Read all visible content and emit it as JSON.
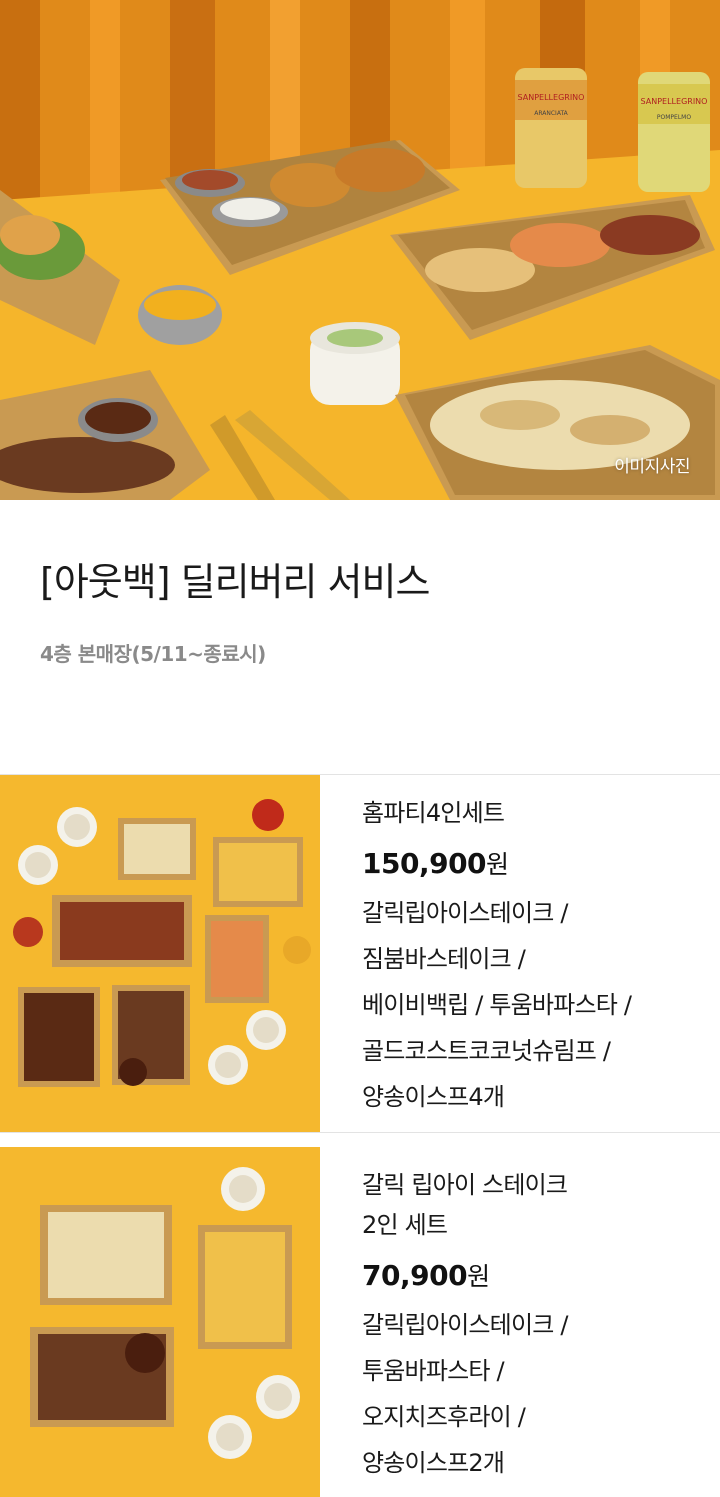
{
  "hero": {
    "caption": "이미지사진",
    "can_brand": "SANPELLEGRINO",
    "can_flavors": [
      "ARANCIATA",
      "POMPELMO"
    ]
  },
  "header": {
    "title": "[아웃백] 딜리버리 서비스",
    "subtitle": "4층 본매장(5/11~종료시)"
  },
  "products": [
    {
      "name_lines": [
        "홈파티4인세트"
      ],
      "price": "150,900",
      "currency": "원",
      "desc_lines": [
        "갈릭립아이스테이크 /",
        "짐붐바스테이크 /",
        "베이비백립 / 투움바파스타 /",
        "골드코스트코코넛슈림프 /",
        "양송이스프4개"
      ]
    },
    {
      "name_lines": [
        "갈릭 립아이 스테이크",
        "2인 세트"
      ],
      "price": "70,900",
      "currency": "원",
      "desc_lines": [
        "갈릭립아이스테이크 /",
        "투움바파스타 /",
        "오지치즈후라이 /",
        "양송이스프2개"
      ]
    }
  ],
  "colors": {
    "hero_background": "#f2b325",
    "curtain": "#e08a1a",
    "table": "#f5b52b",
    "box": "#c99a52",
    "product_bg": "#f5b82e",
    "subtitle": "#8a8a8a",
    "divider": "#e3e3e3"
  }
}
